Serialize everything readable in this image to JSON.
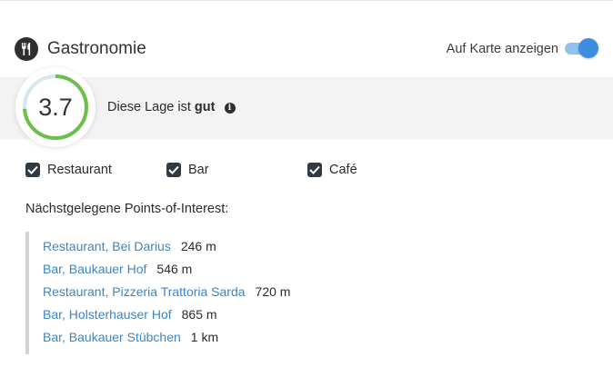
{
  "section": {
    "title": "Gastronomie",
    "icon": "cutlery-icon",
    "map_toggle_label": "Auf Karte anzeigen",
    "map_toggle_on": true
  },
  "rating": {
    "score": "3.7",
    "score_max": 5,
    "text_prefix": "Diese Lage ist",
    "text_grade": "gut",
    "info_icon": "info-icon",
    "colors": {
      "good": "#6cc04a",
      "rest": "#d8e6ef"
    }
  },
  "filters": [
    {
      "label": "Restaurant",
      "checked": true
    },
    {
      "label": "Bar",
      "checked": true
    },
    {
      "label": "Café",
      "checked": true
    }
  ],
  "poi": {
    "heading": "Nächstgelegene Points-of-Interest:",
    "items": [
      {
        "name": "Restaurant, Bei Darius",
        "distance": "246 m"
      },
      {
        "name": "Bar, Baukauer Hof",
        "distance": "546 m"
      },
      {
        "name": "Restaurant, Pizzeria Trattoria Sarda",
        "distance": "720 m"
      },
      {
        "name": "Bar, Holsterhauser Hof",
        "distance": "865 m"
      },
      {
        "name": "Bar, Baukauer Stübchen",
        "distance": "1 km"
      }
    ]
  },
  "colors": {
    "link": "#3b86c4",
    "toggle": "#3d8ee0",
    "checkbox": "#2f3a44"
  }
}
